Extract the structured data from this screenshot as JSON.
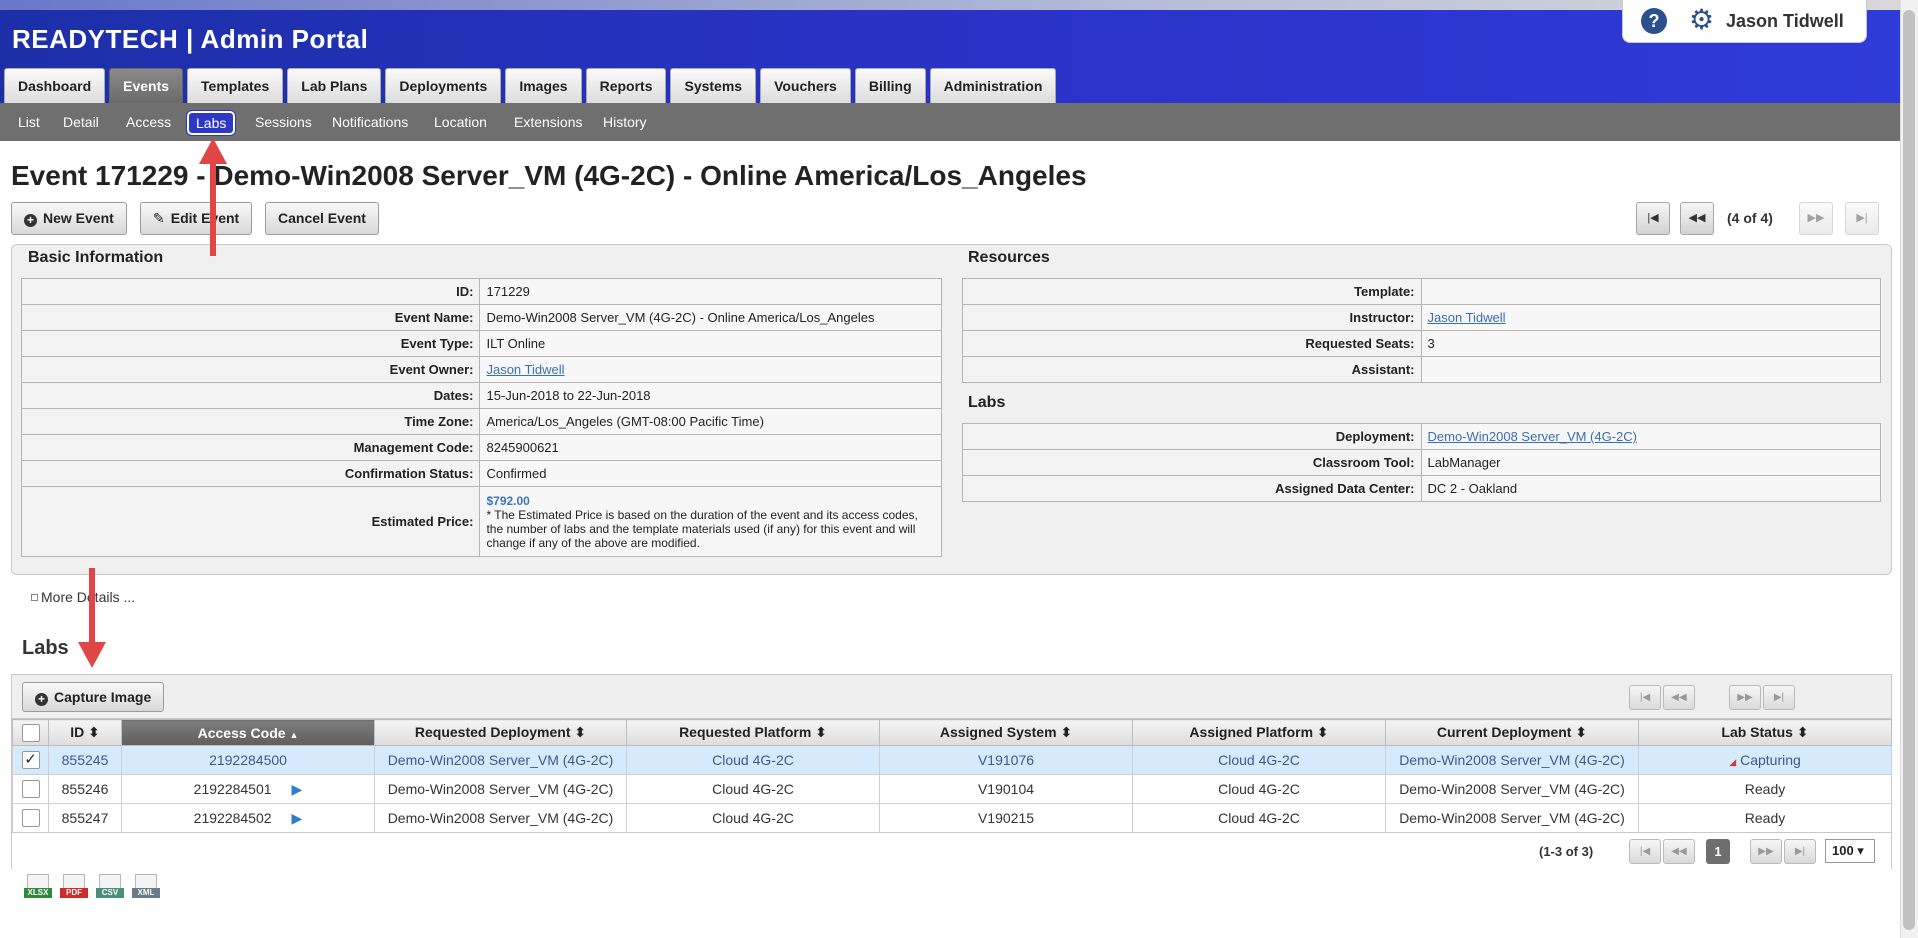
{
  "app": {
    "brand": "READYTECH | Admin Portal"
  },
  "user": {
    "name": "Jason Tidwell",
    "help_glyph": "?",
    "settings_glyph": "⚙"
  },
  "main_tabs": [
    {
      "label": "Dashboard"
    },
    {
      "label": "Events",
      "active": true
    },
    {
      "label": "Templates"
    },
    {
      "label": "Lab Plans"
    },
    {
      "label": "Deployments"
    },
    {
      "label": "Images"
    },
    {
      "label": "Reports"
    },
    {
      "label": "Systems"
    },
    {
      "label": "Vouchers"
    },
    {
      "label": "Billing"
    },
    {
      "label": "Administration"
    }
  ],
  "sub_tabs": [
    {
      "label": "List"
    },
    {
      "label": "Detail"
    },
    {
      "label": "Access"
    },
    {
      "label": "Labs",
      "active": true
    },
    {
      "label": "Sessions"
    },
    {
      "label": "Notifications"
    },
    {
      "label": "Location"
    },
    {
      "label": "Extensions"
    },
    {
      "label": "History"
    }
  ],
  "page": {
    "title": "Event 171229 - Demo-Win2008 Server_VM (4G-2C) - Online America/Los_Angeles",
    "buttons": {
      "new_event": "New Event",
      "edit_event": "Edit Event",
      "cancel_event": "Cancel Event"
    },
    "record_pager": "(4 of 4)"
  },
  "basic_info": {
    "title": "Basic Information",
    "id_label": "ID:",
    "id": "171229",
    "name_label": "Event Name:",
    "name": "Demo-Win2008 Server_VM (4G-2C) - Online America/Los_Angeles",
    "type_label": "Event Type:",
    "type": "ILT Online",
    "owner_label": "Event Owner:",
    "owner": "Jason Tidwell",
    "dates_label": "Dates:",
    "dates": "15-Jun-2018 to 22-Jun-2018",
    "timezone_label": "Time Zone:",
    "timezone": "America/Los_Angeles (GMT-08:00 Pacific Time)",
    "mgmt_label": "Management Code:",
    "mgmt_code": "8245900621",
    "conf_label": "Confirmation Status:",
    "confirmation": "Confirmed",
    "price_label": "Estimated Price:",
    "price": "$792.00",
    "price_note": "* The Estimated Price is based on the duration of the event and its access codes, the number of labs and the template materials used (if any) for this event and will change if any of the above are modified."
  },
  "resources": {
    "title": "Resources",
    "template_label": "Template:",
    "template": "",
    "instructor_label": "Instructor:",
    "instructor": "Jason Tidwell",
    "seats_label": "Requested Seats:",
    "seats": "3",
    "assistant_label": "Assistant:",
    "assistant": ""
  },
  "labs_info": {
    "title": "Labs",
    "deployment_label": "Deployment:",
    "deployment": "Demo-Win2008 Server_VM (4G-2C)",
    "tool_label": "Classroom Tool:",
    "tool": "LabManager",
    "dc_label": "Assigned Data Center:",
    "dc": "DC 2 - Oakland"
  },
  "more_details": "More Details ...",
  "labs_grid": {
    "title": "Labs",
    "capture_button": "Capture Image",
    "columns": [
      "ID",
      "Access Code",
      "Requested Deployment",
      "Requested Platform",
      "Assigned System",
      "Assigned Platform",
      "Current Deployment",
      "Lab Status"
    ],
    "sort_glyph": "⬍",
    "sort_asc_glyph": "▲",
    "rows": [
      {
        "checked": true,
        "id": "855245",
        "access_code": "2192284500",
        "req_deployment": "Demo-Win2008 Server_VM (4G-2C)",
        "req_platform": "Cloud 4G-2C",
        "system": "V191076",
        "platform": "Cloud 4G-2C",
        "cur_deployment": "Demo-Win2008 Server_VM (4G-2C)",
        "status": "Capturing"
      },
      {
        "checked": false,
        "id": "855246",
        "access_code": "2192284501",
        "req_deployment": "Demo-Win2008 Server_VM (4G-2C)",
        "req_platform": "Cloud 4G-2C",
        "system": "V190104",
        "platform": "Cloud 4G-2C",
        "cur_deployment": "Demo-Win2008 Server_VM (4G-2C)",
        "status": "Ready"
      },
      {
        "checked": false,
        "id": "855247",
        "access_code": "2192284502",
        "req_deployment": "Demo-Win2008 Server_VM (4G-2C)",
        "req_platform": "Cloud 4G-2C",
        "system": "V190215",
        "platform": "Cloud 4G-2C",
        "cur_deployment": "Demo-Win2008 Server_VM (4G-2C)",
        "status": "Ready"
      }
    ],
    "footer": {
      "rows_text": "(1-3 of 3)",
      "current_page": "1",
      "page_size": "100 ▾"
    }
  },
  "exports": [
    {
      "label": "XLSX",
      "color": "#2e8b3a"
    },
    {
      "label": "PDF",
      "color": "#d12a2a"
    },
    {
      "label": "CSV",
      "color": "#4a8f7a"
    },
    {
      "label": "XML",
      "color": "#6a7a8a"
    }
  ],
  "colors": {
    "header_blue": "#2a33c9",
    "subnav_gray": "#6f6f6f",
    "link": "#3b6db3",
    "annotation_arrow": "#e04646",
    "selected_row": "#d5ebfb"
  }
}
